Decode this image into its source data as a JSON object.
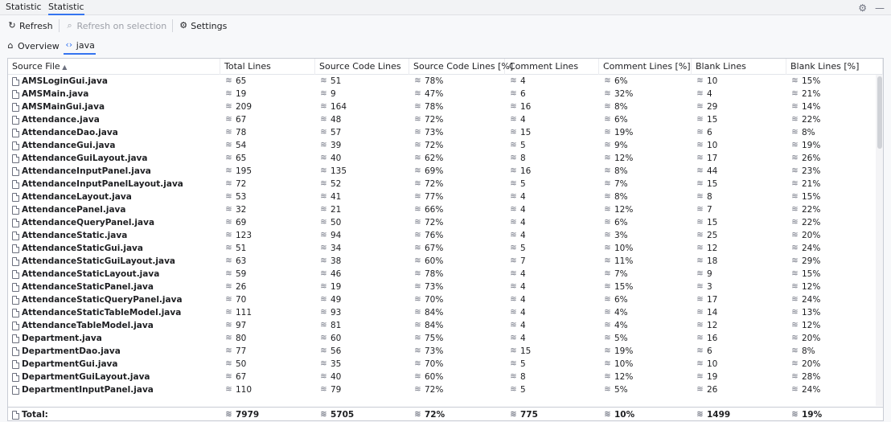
{
  "tabs": [
    "Statistic",
    "Statistic"
  ],
  "toolbar": {
    "refresh": "Refresh",
    "refresh_selection": "Refresh on selection",
    "settings": "Settings"
  },
  "breadcrumb": {
    "overview": "Overview",
    "current": "java"
  },
  "columns": [
    "Source File",
    "Total Lines",
    "Source Code Lines",
    "Source Code Lines [%]",
    "Comment Lines",
    "Comment Lines [%]",
    "Blank Lines",
    "Blank Lines [%]"
  ],
  "rows": [
    [
      "AMSLoginGui.java",
      "65",
      "51",
      "78%",
      "4",
      "6%",
      "10",
      "15%"
    ],
    [
      "AMSMain.java",
      "19",
      "9",
      "47%",
      "6",
      "32%",
      "4",
      "21%"
    ],
    [
      "AMSMainGui.java",
      "209",
      "164",
      "78%",
      "16",
      "8%",
      "29",
      "14%"
    ],
    [
      "Attendance.java",
      "67",
      "48",
      "72%",
      "4",
      "6%",
      "15",
      "22%"
    ],
    [
      "AttendanceDao.java",
      "78",
      "57",
      "73%",
      "15",
      "19%",
      "6",
      "8%"
    ],
    [
      "AttendanceGui.java",
      "54",
      "39",
      "72%",
      "5",
      "9%",
      "10",
      "19%"
    ],
    [
      "AttendanceGuiLayout.java",
      "65",
      "40",
      "62%",
      "8",
      "12%",
      "17",
      "26%"
    ],
    [
      "AttendanceInputPanel.java",
      "195",
      "135",
      "69%",
      "16",
      "8%",
      "44",
      "23%"
    ],
    [
      "AttendanceInputPanelLayout.java",
      "72",
      "52",
      "72%",
      "5",
      "7%",
      "15",
      "21%"
    ],
    [
      "AttendanceLayout.java",
      "53",
      "41",
      "77%",
      "4",
      "8%",
      "8",
      "15%"
    ],
    [
      "AttendancePanel.java",
      "32",
      "21",
      "66%",
      "4",
      "12%",
      "7",
      "22%"
    ],
    [
      "AttendanceQueryPanel.java",
      "69",
      "50",
      "72%",
      "4",
      "6%",
      "15",
      "22%"
    ],
    [
      "AttendanceStatic.java",
      "123",
      "94",
      "76%",
      "4",
      "3%",
      "25",
      "20%"
    ],
    [
      "AttendanceStaticGui.java",
      "51",
      "34",
      "67%",
      "5",
      "10%",
      "12",
      "24%"
    ],
    [
      "AttendanceStaticGuiLayout.java",
      "63",
      "38",
      "60%",
      "7",
      "11%",
      "18",
      "29%"
    ],
    [
      "AttendanceStaticLayout.java",
      "59",
      "46",
      "78%",
      "4",
      "7%",
      "9",
      "15%"
    ],
    [
      "AttendanceStaticPanel.java",
      "26",
      "19",
      "73%",
      "4",
      "15%",
      "3",
      "12%"
    ],
    [
      "AttendanceStaticQueryPanel.java",
      "70",
      "49",
      "70%",
      "4",
      "6%",
      "17",
      "24%"
    ],
    [
      "AttendanceStaticTableModel.java",
      "111",
      "93",
      "84%",
      "4",
      "4%",
      "14",
      "13%"
    ],
    [
      "AttendanceTableModel.java",
      "97",
      "81",
      "84%",
      "4",
      "4%",
      "12",
      "12%"
    ],
    [
      "Department.java",
      "80",
      "60",
      "75%",
      "4",
      "5%",
      "16",
      "20%"
    ],
    [
      "DepartmentDao.java",
      "77",
      "56",
      "73%",
      "15",
      "19%",
      "6",
      "8%"
    ],
    [
      "DepartmentGui.java",
      "50",
      "35",
      "70%",
      "5",
      "10%",
      "10",
      "20%"
    ],
    [
      "DepartmentGuiLayout.java",
      "67",
      "40",
      "60%",
      "8",
      "12%",
      "19",
      "28%"
    ],
    [
      "DepartmentInputPanel.java",
      "110",
      "79",
      "72%",
      "5",
      "5%",
      "26",
      "24%"
    ]
  ],
  "totals": [
    "Total:",
    "7979",
    "5705",
    "72%",
    "775",
    "10%",
    "1499",
    "19%"
  ],
  "colors": {
    "accent": "#3574f0",
    "icon": "#6c707e"
  },
  "icons": {
    "refresh": "refresh-icon",
    "refresh_selection": "search-icon",
    "settings": "gear-icon",
    "overview": "home-icon",
    "java": "code-icon",
    "file": "file-icon",
    "value": "database-icon",
    "sort": "sort-up-icon"
  }
}
